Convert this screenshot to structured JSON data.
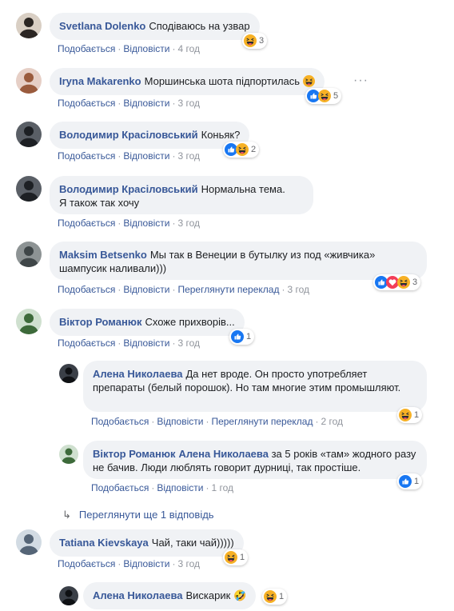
{
  "colors": {
    "link": "#385898",
    "bubble": "#f0f2f5",
    "meta": "#90949c",
    "like": "#1877f2",
    "haha": "#f7b125",
    "love": "#f33e58"
  },
  "icons": {
    "like": "like-icon",
    "haha": "haha-icon",
    "love": "love-icon",
    "reply_arrow": "reply-arrow-icon",
    "more": "more-options-icon"
  },
  "comments": [
    {
      "author": "Svetlana Dolenko",
      "text": "Сподіваюсь на узвар",
      "like": "Подобається",
      "reply": "Відповісти",
      "time": "4 год",
      "reaction_count": "3"
    },
    {
      "author": "Iryna Makarenko",
      "text": "Моршинська шота підпортилась",
      "like": "Подобається",
      "reply": "Відповісти",
      "time": "3 год",
      "reaction_count": "5",
      "more": "···"
    },
    {
      "author": "Володимир Красіловський",
      "text": "Коньяк?",
      "like": "Подобається",
      "reply": "Відповісти",
      "time": "3 год",
      "reaction_count": "2"
    },
    {
      "author": "Володимир Красіловський",
      "text": "Нормальна тема.",
      "text2": "Я також так хочу",
      "like": "Подобається",
      "reply": "Відповісти",
      "time": "3 год"
    },
    {
      "author": "Maksim Betsenko",
      "text": "Мы так в Венеции в бутылку из под «живчика» шампусик наливали)))",
      "like": "Подобається",
      "reply": "Відповісти",
      "translate": "Переглянути переклад",
      "time": "3 год",
      "reaction_count": "3"
    },
    {
      "author": "Віктор Романюк",
      "text": "Схоже прихворів...",
      "like": "Подобається",
      "reply": "Відповісти",
      "time": "3 год",
      "reaction_count": "1"
    },
    {
      "author": "Алена Николаева",
      "text": "Да нет вроде. Он просто употребляет препараты (белый порошок). Но там многие этим промышляют.",
      "like": "Подобається",
      "reply": "Відповісти",
      "translate": "Переглянути переклад",
      "time": "2 год",
      "reaction_count": "1"
    },
    {
      "author": "Віктор Романюк",
      "mention": "Алена Николаева",
      "text": "за 5 років «там» жодного разу не бачив. Люди люблять говорит дурниці, так простіше.",
      "like": "Подобається",
      "reply": "Відповісти",
      "time": "1 год",
      "reaction_count": "1"
    },
    {
      "view_more": "Переглянути ще 1 відповідь"
    },
    {
      "author": "Tatiana Kievskaya",
      "text": "Чай, таки чай)))))",
      "like": "Подобається",
      "reply": "Відповісти",
      "time": "3 год",
      "reaction_count": "1"
    },
    {
      "author": "Алена Николаева",
      "text": "Вискарик",
      "emoji": "🤣",
      "reaction_count": "1"
    }
  ]
}
